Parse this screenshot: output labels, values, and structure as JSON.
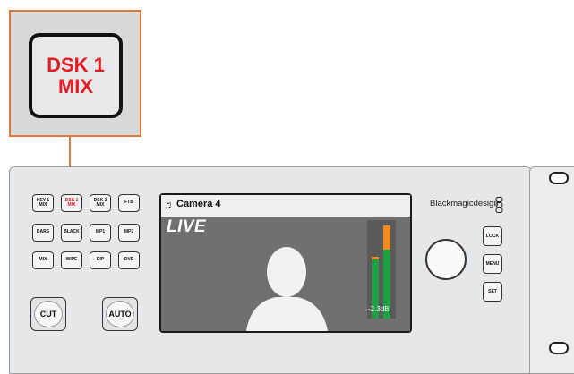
{
  "callout": {
    "line1": "DSK 1",
    "line2": "MIX"
  },
  "keys": {
    "key1_mix": [
      "KEY 1",
      "MIX"
    ],
    "dsk1_mix": [
      "DSK 1",
      "MIX"
    ],
    "dsk2_mix": [
      "DSK 2",
      "MIX"
    ],
    "ftb": "FTB",
    "bars": "BARS",
    "black": "BLACK",
    "mp1": "MP1",
    "mp2": "MP2",
    "mix": "MIX",
    "wipe": "WIPE",
    "dip": "DIP",
    "dve": "DVE",
    "cut": "CUT",
    "auto": "AUTO"
  },
  "lcd": {
    "title": "Camera 4",
    "status": "LIVE",
    "meter_db": "-2.3dB",
    "meter_levels": {
      "left_green": 0.6,
      "left_orange": 0.03,
      "right_green": 0.7,
      "right_orange": 0.25
    }
  },
  "brand": "Blackmagicdesign",
  "right_keys": {
    "lock": "LOCK",
    "menu": "MENU",
    "set": "SET"
  },
  "colors": {
    "callout_border": "#e07a3a",
    "active_text": "#e31b23",
    "meter_green": "#1fa045",
    "meter_orange": "#f08a1e"
  }
}
